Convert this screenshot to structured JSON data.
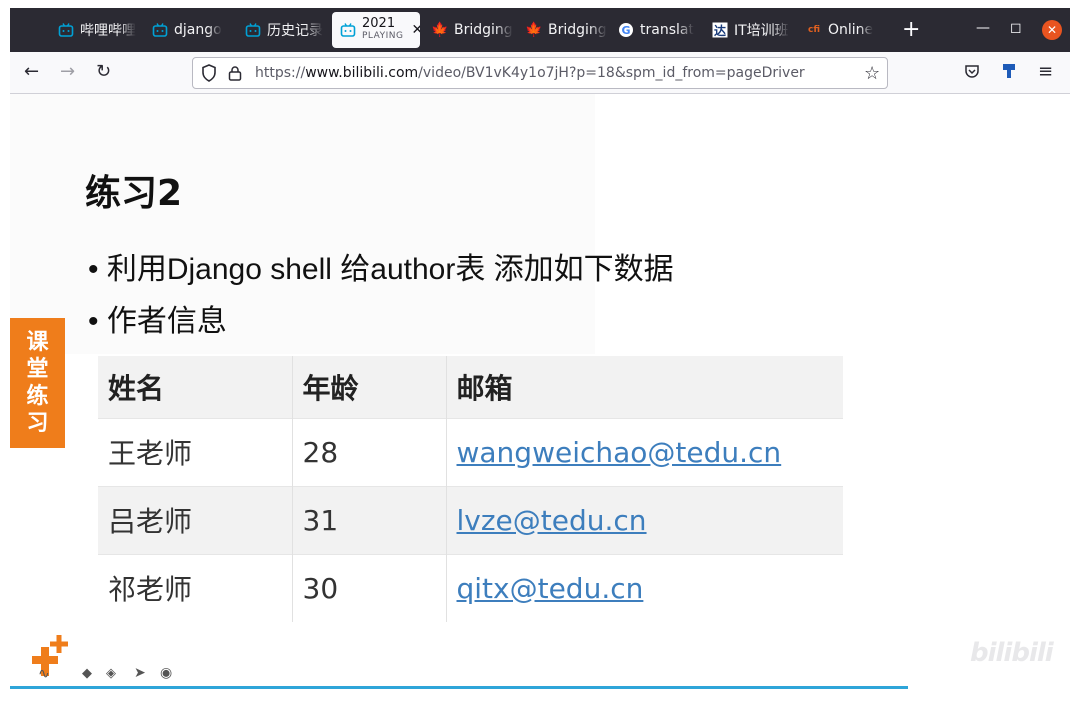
{
  "browser": {
    "tabs": [
      {
        "label": "哔哩哔哩",
        "icon": "bilibili-icon"
      },
      {
        "label": "django",
        "icon": "bilibili-icon"
      },
      {
        "label": "历史记录",
        "icon": "bilibili-icon"
      },
      {
        "label": "2021",
        "sublabel": "PLAYING",
        "icon": "bilibili-icon",
        "active": true
      },
      {
        "label": "Bridging",
        "icon": "maple-leaf-icon"
      },
      {
        "label": "Bridging",
        "icon": "maple-leaf-icon"
      },
      {
        "label": "translat",
        "icon": "google-icon"
      },
      {
        "label": "IT培训班",
        "icon": "da-icon"
      },
      {
        "label": "Online",
        "icon": "cfi-icon"
      }
    ],
    "new_tab": "+",
    "url_host": "www.bilibili.com",
    "url_prefix": "https://",
    "url_path": "/video/BV1vK4y1o7jH?p=18&spm_id_from=pageDriver"
  },
  "slide": {
    "title": "练习2",
    "bullets": [
      "• 利用Django shell 给author表 添加如下数据",
      "• 作者信息"
    ],
    "side_badge": [
      "课",
      "堂",
      "练",
      "习"
    ],
    "table": {
      "headers": [
        "姓名",
        "年龄",
        "邮箱"
      ],
      "rows": [
        [
          "王老师",
          "28",
          "wangweichao@tedu.cn"
        ],
        [
          "吕老师",
          "31",
          "lvze@tedu.cn"
        ],
        [
          "祁老师",
          "30",
          "qitx@tedu.cn"
        ]
      ]
    }
  },
  "watermark": "bilibili",
  "colors": {
    "tabstrip": "#2b2a33",
    "accent_orange": "#ef7d1b",
    "link": "#3d7ebd",
    "progress": "#2ea5d9",
    "close_button": "#e95420",
    "bilibili_blue": "#00a1d6"
  }
}
